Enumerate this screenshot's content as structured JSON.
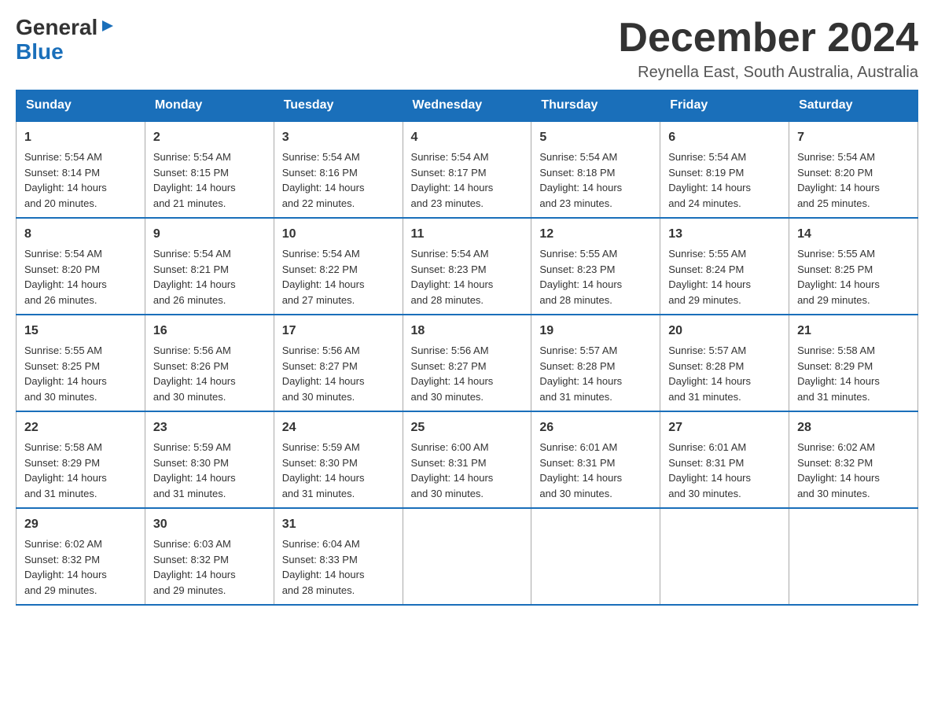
{
  "header": {
    "logo": {
      "general": "General",
      "arrow": "▶",
      "blue": "Blue"
    },
    "month_title": "December 2024",
    "location": "Reynella East, South Australia, Australia"
  },
  "days_of_week": [
    "Sunday",
    "Monday",
    "Tuesday",
    "Wednesday",
    "Thursday",
    "Friday",
    "Saturday"
  ],
  "weeks": [
    [
      {
        "day": "1",
        "sunrise": "5:54 AM",
        "sunset": "8:14 PM",
        "daylight": "14 hours and 20 minutes."
      },
      {
        "day": "2",
        "sunrise": "5:54 AM",
        "sunset": "8:15 PM",
        "daylight": "14 hours and 21 minutes."
      },
      {
        "day": "3",
        "sunrise": "5:54 AM",
        "sunset": "8:16 PM",
        "daylight": "14 hours and 22 minutes."
      },
      {
        "day": "4",
        "sunrise": "5:54 AM",
        "sunset": "8:17 PM",
        "daylight": "14 hours and 23 minutes."
      },
      {
        "day": "5",
        "sunrise": "5:54 AM",
        "sunset": "8:18 PM",
        "daylight": "14 hours and 23 minutes."
      },
      {
        "day": "6",
        "sunrise": "5:54 AM",
        "sunset": "8:19 PM",
        "daylight": "14 hours and 24 minutes."
      },
      {
        "day": "7",
        "sunrise": "5:54 AM",
        "sunset": "8:20 PM",
        "daylight": "14 hours and 25 minutes."
      }
    ],
    [
      {
        "day": "8",
        "sunrise": "5:54 AM",
        "sunset": "8:20 PM",
        "daylight": "14 hours and 26 minutes."
      },
      {
        "day": "9",
        "sunrise": "5:54 AM",
        "sunset": "8:21 PM",
        "daylight": "14 hours and 26 minutes."
      },
      {
        "day": "10",
        "sunrise": "5:54 AM",
        "sunset": "8:22 PM",
        "daylight": "14 hours and 27 minutes."
      },
      {
        "day": "11",
        "sunrise": "5:54 AM",
        "sunset": "8:23 PM",
        "daylight": "14 hours and 28 minutes."
      },
      {
        "day": "12",
        "sunrise": "5:55 AM",
        "sunset": "8:23 PM",
        "daylight": "14 hours and 28 minutes."
      },
      {
        "day": "13",
        "sunrise": "5:55 AM",
        "sunset": "8:24 PM",
        "daylight": "14 hours and 29 minutes."
      },
      {
        "day": "14",
        "sunrise": "5:55 AM",
        "sunset": "8:25 PM",
        "daylight": "14 hours and 29 minutes."
      }
    ],
    [
      {
        "day": "15",
        "sunrise": "5:55 AM",
        "sunset": "8:25 PM",
        "daylight": "14 hours and 30 minutes."
      },
      {
        "day": "16",
        "sunrise": "5:56 AM",
        "sunset": "8:26 PM",
        "daylight": "14 hours and 30 minutes."
      },
      {
        "day": "17",
        "sunrise": "5:56 AM",
        "sunset": "8:27 PM",
        "daylight": "14 hours and 30 minutes."
      },
      {
        "day": "18",
        "sunrise": "5:56 AM",
        "sunset": "8:27 PM",
        "daylight": "14 hours and 30 minutes."
      },
      {
        "day": "19",
        "sunrise": "5:57 AM",
        "sunset": "8:28 PM",
        "daylight": "14 hours and 31 minutes."
      },
      {
        "day": "20",
        "sunrise": "5:57 AM",
        "sunset": "8:28 PM",
        "daylight": "14 hours and 31 minutes."
      },
      {
        "day": "21",
        "sunrise": "5:58 AM",
        "sunset": "8:29 PM",
        "daylight": "14 hours and 31 minutes."
      }
    ],
    [
      {
        "day": "22",
        "sunrise": "5:58 AM",
        "sunset": "8:29 PM",
        "daylight": "14 hours and 31 minutes."
      },
      {
        "day": "23",
        "sunrise": "5:59 AM",
        "sunset": "8:30 PM",
        "daylight": "14 hours and 31 minutes."
      },
      {
        "day": "24",
        "sunrise": "5:59 AM",
        "sunset": "8:30 PM",
        "daylight": "14 hours and 31 minutes."
      },
      {
        "day": "25",
        "sunrise": "6:00 AM",
        "sunset": "8:31 PM",
        "daylight": "14 hours and 30 minutes."
      },
      {
        "day": "26",
        "sunrise": "6:01 AM",
        "sunset": "8:31 PM",
        "daylight": "14 hours and 30 minutes."
      },
      {
        "day": "27",
        "sunrise": "6:01 AM",
        "sunset": "8:31 PM",
        "daylight": "14 hours and 30 minutes."
      },
      {
        "day": "28",
        "sunrise": "6:02 AM",
        "sunset": "8:32 PM",
        "daylight": "14 hours and 30 minutes."
      }
    ],
    [
      {
        "day": "29",
        "sunrise": "6:02 AM",
        "sunset": "8:32 PM",
        "daylight": "14 hours and 29 minutes."
      },
      {
        "day": "30",
        "sunrise": "6:03 AM",
        "sunset": "8:32 PM",
        "daylight": "14 hours and 29 minutes."
      },
      {
        "day": "31",
        "sunrise": "6:04 AM",
        "sunset": "8:33 PM",
        "daylight": "14 hours and 28 minutes."
      },
      null,
      null,
      null,
      null
    ]
  ],
  "labels": {
    "sunrise_prefix": "Sunrise: ",
    "sunset_prefix": "Sunset: ",
    "daylight_prefix": "Daylight: "
  }
}
